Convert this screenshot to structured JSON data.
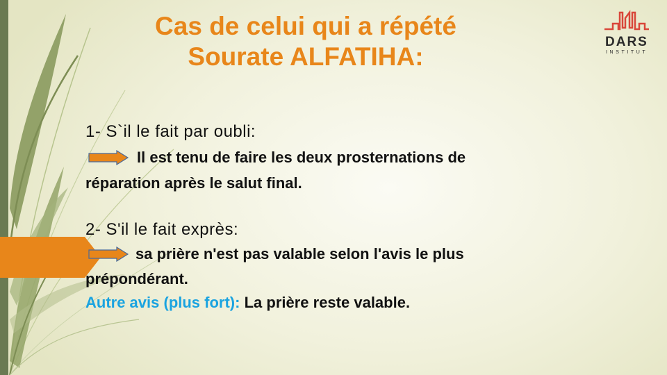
{
  "slide": {
    "title_line1": "Cas de celui qui a répété",
    "title_line2": "Sourate ALFATIHA:",
    "logo": {
      "name": "DARS",
      "subtitle": "INSTITUT"
    },
    "cases": [
      {
        "heading": "1- S`il le fait par oubli:",
        "arrow_icon": "right-arrow-icon",
        "line1": "Il est tenu de faire les deux prosternations de",
        "line2": "réparation après le salut final."
      },
      {
        "heading": "2- S'il le fait exprès:",
        "arrow_icon": "right-arrow-icon",
        "line1": "sa prière n'est pas valable selon l'avis le plus",
        "line2": "prépondérant."
      }
    ],
    "other_opinion": {
      "label": "Autre avis (plus fort):",
      "text": "La prière reste valable."
    },
    "colors": {
      "title": "#e8861a",
      "accent_blue": "#1aa3e0",
      "arrow_fill": "#e8861a",
      "arrow_stroke": "#4a6a9a",
      "left_bar": "#6a7a52",
      "logo_red": "#d9473a"
    }
  }
}
